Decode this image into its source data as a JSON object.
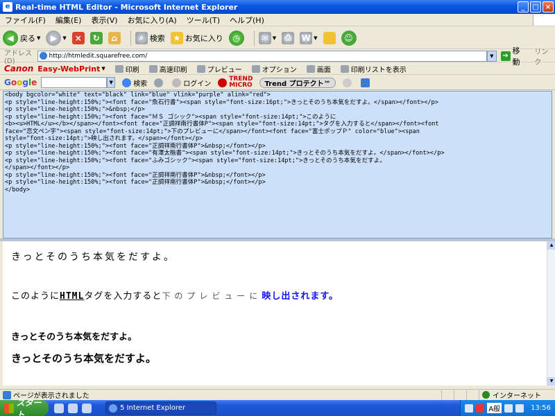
{
  "window": {
    "title": "Real-time HTML Editor - Microsoft Internet Explorer",
    "app_icon": "ie-icon"
  },
  "menu": [
    "ファイル(F)",
    "編集(E)",
    "表示(V)",
    "お気に入り(A)",
    "ツール(T)",
    "ヘルプ(H)"
  ],
  "toolbar": {
    "back": "戻る",
    "search": "検索",
    "favorites": "お気に入り"
  },
  "address": {
    "label": "アドレス(D)",
    "url": "http://htmledit.squarefree.com/",
    "go": "移動",
    "links": "リンク"
  },
  "canon_bar": {
    "brand": "Canon",
    "product": "Easy-WebPrint",
    "items": [
      "印刷",
      "高速印刷",
      "プレビュー",
      "オプション",
      "画面",
      "印刷リストを表示"
    ]
  },
  "google_bar": {
    "search": "検索",
    "login": "ログイン",
    "trend_line1": "TREND",
    "trend_line2": "MICRO",
    "trend_protect": "Trend プロテクト™"
  },
  "editor_lines": [
    "<body bgcolor=\"white\" text=\"black\" link=\"blue\" vlink=\"purple\" alink=\"red\">",
    "<p style=\"line-height:150%;\"><font face=\"魚石行書\"><span style=\"font-size:16pt;\">きっとそのうち本気をだすよ。</span></font></p>",
    "<p style=\"line-height:150%;\">&nbsp;</p>",
    "<p style=\"line-height:150%;\"><font face=\"ＭＳ ゴシック\"><span style=\"font-size:14pt;\">このように",
    "<b><u>HTML</u></b></span></font><font face=\"正調祥南行書体P\"><span style=\"font-size:14pt;\">タグを入力すると</span></font><font",
    "face=\"恋文ペン字\"><span style=\"font-size:14pt;\">下のプレビューに</span></font><font face=\"富士ポップＰ\" color=\"blue\"><span",
    "style=\"font-size:14pt;\">映し出されます。</span></font></p>",
    "<p style=\"line-height:150%;\"><font face=\"正調祥南行書体P\">&nbsp;</font></p>",
    "<p style=\"line-height:150%;\"><font face=\"有澤太楷書\"><span style=\"font-size:14pt;\">きっとそのうち本気をだすよ。</span></font></p>",
    "<p style=\"line-height:150%;\"><font face=\"ふみゴシック\"><span style=\"font-size:14pt;\">きっとそのうち本気をだすよ。",
    "</span></font></p>",
    "<p style=\"line-height:150%;\"><font face=\"正調祥南行書体P\">&nbsp;</font></p>",
    "<p style=\"line-height:150%;\"><font face=\"正調祥南行書体P\">&nbsp;</font></p>",
    "</body>"
  ],
  "preview": {
    "line1": "きっとそのうち本気をだすよ。",
    "line2_a": "このように",
    "line2_html": "HTML",
    "line2_b": "タグを入力すると",
    "line2_c": "下のプレビューに",
    "line2_d": "映し出されます。",
    "line4": "きっとそのうち本気をだすよ。",
    "line5": "きっとそのうち本気をだすよ。",
    "link_color": "#1010ff"
  },
  "status": {
    "text": "ページが表示されました",
    "zone": "インターネット"
  },
  "taskbar": {
    "start": "スタート",
    "task": "5 Internet Explorer",
    "ime": "A般",
    "clock": "13:56"
  }
}
